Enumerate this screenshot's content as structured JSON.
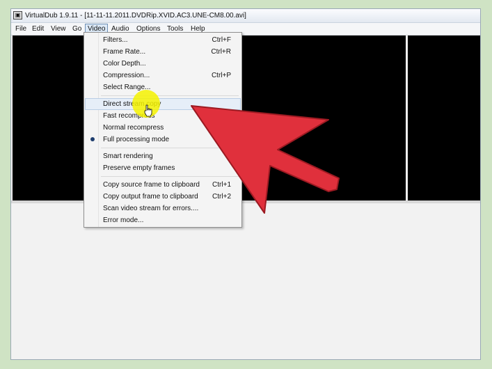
{
  "window": {
    "title": "VirtualDub 1.9.11 - [11-11-11.2011.DVDRip.XVID.AC3.UNE-CM8.00.avi]"
  },
  "menubar": {
    "file": "File",
    "edit": "Edit",
    "view": "View",
    "go": "Go",
    "video": "Video",
    "audio": "Audio",
    "options": "Options",
    "tools": "Tools",
    "help": "Help"
  },
  "video_menu": {
    "filters": {
      "label": "Filters...",
      "shortcut": "Ctrl+F"
    },
    "frame_rate": {
      "label": "Frame Rate...",
      "shortcut": "Ctrl+R"
    },
    "color_depth": {
      "label": "Color Depth..."
    },
    "compression": {
      "label": "Compression...",
      "shortcut": "Ctrl+P"
    },
    "select_range": {
      "label": "Select Range..."
    },
    "direct_stream_copy": {
      "label": "Direct stream copy"
    },
    "fast_recompress": {
      "label": "Fast recompress"
    },
    "normal_recompress": {
      "label": "Normal recompress"
    },
    "full_processing_mode": {
      "label": "Full processing mode"
    },
    "smart_rendering": {
      "label": "Smart rendering"
    },
    "preserve_empty_frames": {
      "label": "Preserve empty frames"
    },
    "copy_source_frame": {
      "label": "Copy source frame to clipboard",
      "shortcut": "Ctrl+1"
    },
    "copy_output_frame": {
      "label": "Copy output frame to clipboard",
      "shortcut": "Ctrl+2"
    },
    "scan_video_stream": {
      "label": "Scan video stream for errors...."
    },
    "error_mode": {
      "label": "Error mode..."
    }
  },
  "colors": {
    "background": "#cfe3c4",
    "arrow_fill": "#e0303c",
    "highlight": "#f4f200",
    "video_pane": "#000000"
  }
}
